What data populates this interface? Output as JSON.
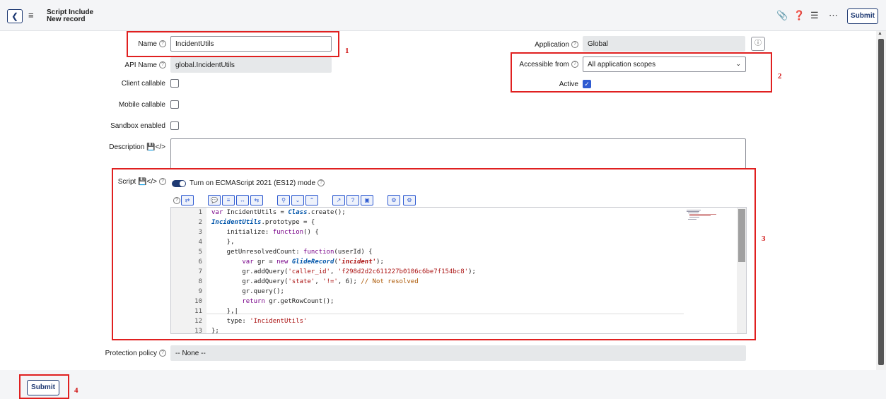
{
  "header": {
    "title_line1": "Script Include",
    "title_line2": "New record",
    "submit_label": "Submit"
  },
  "form": {
    "name": {
      "label": "Name",
      "value": "IncidentUtils"
    },
    "api_name": {
      "label": "API Name",
      "value": "global.IncidentUtils"
    },
    "client_callable": {
      "label": "Client callable",
      "checked": false
    },
    "mobile_callable": {
      "label": "Mobile callable",
      "checked": false
    },
    "sandbox_enabled": {
      "label": "Sandbox enabled",
      "checked": false
    },
    "description": {
      "label": "Description",
      "value": ""
    },
    "application": {
      "label": "Application",
      "value": "Global"
    },
    "accessible_from": {
      "label": "Accessible from",
      "value": "All application scopes"
    },
    "active": {
      "label": "Active",
      "checked": true
    },
    "script": {
      "label": "Script",
      "es_toggle_label": "Turn on ECMAScript 2021 (ES12) mode",
      "line_numbers": [
        "1",
        "2",
        "3",
        "4",
        "5",
        "6",
        "7",
        "8",
        "9",
        "10",
        "11",
        "12",
        "13"
      ]
    },
    "protection_policy": {
      "label": "Protection policy",
      "value": "-- None --"
    }
  },
  "annotations": [
    "1",
    "2",
    "3",
    "4"
  ],
  "footer": {
    "submit_label": "Submit"
  },
  "colors": {
    "accent": "#1f3a73",
    "checkbox_on": "#2f5bd1",
    "annotation_red": "#e02020"
  }
}
